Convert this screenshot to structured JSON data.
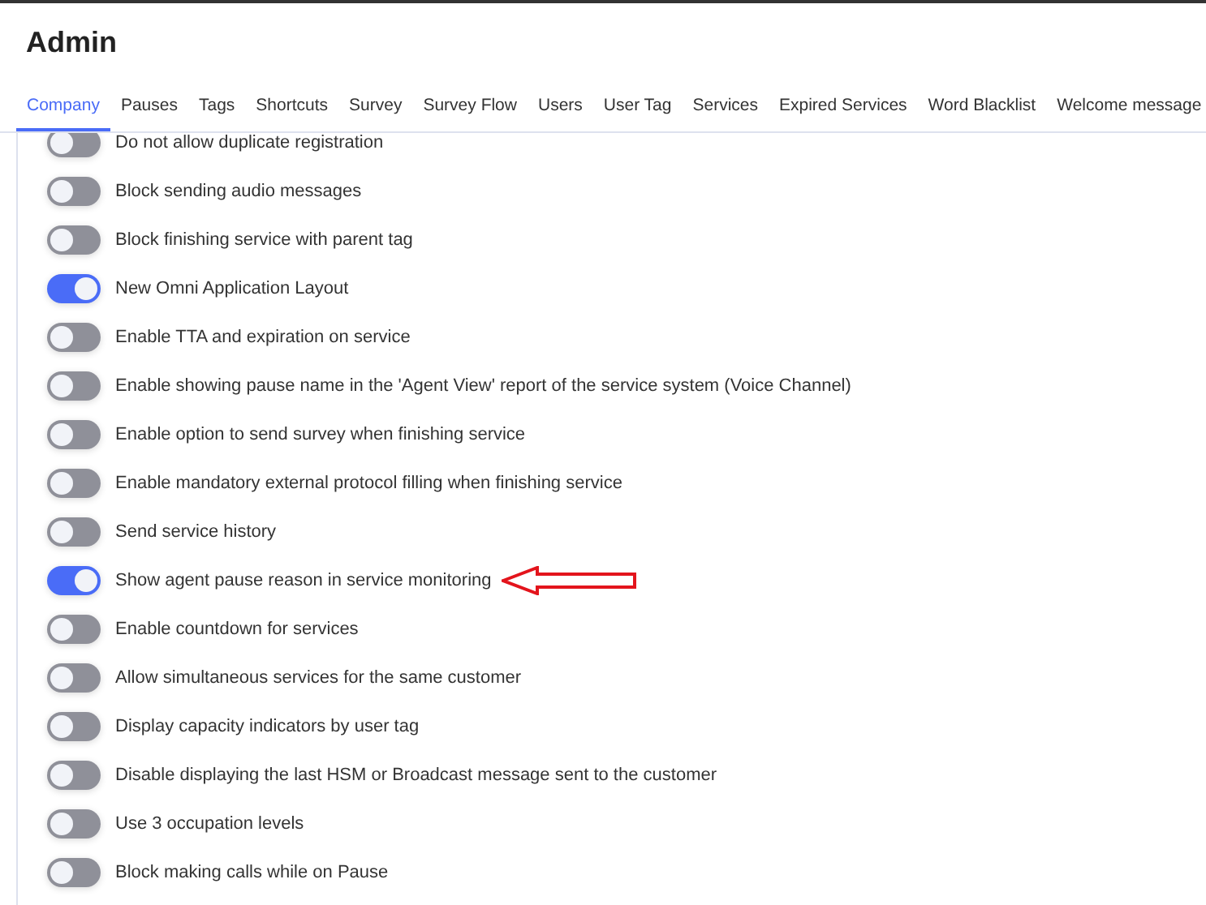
{
  "title": "Admin",
  "tabs": [
    {
      "label": "Company",
      "selected": true
    },
    {
      "label": "Pauses",
      "selected": false
    },
    {
      "label": "Tags",
      "selected": false
    },
    {
      "label": "Shortcuts",
      "selected": false
    },
    {
      "label": "Survey",
      "selected": false
    },
    {
      "label": "Survey Flow",
      "selected": false
    },
    {
      "label": "Users",
      "selected": false
    },
    {
      "label": "User Tag",
      "selected": false
    },
    {
      "label": "Services",
      "selected": false
    },
    {
      "label": "Expired Services",
      "selected": false
    },
    {
      "label": "Word Blacklist",
      "selected": false
    },
    {
      "label": "Welcome message",
      "selected": false
    }
  ],
  "settings": [
    {
      "label": "Do not allow duplicate registration",
      "on": false,
      "highlighted": false
    },
    {
      "label": "Block sending audio messages",
      "on": false,
      "highlighted": false
    },
    {
      "label": "Block finishing service with parent tag",
      "on": false,
      "highlighted": false
    },
    {
      "label": "New Omni Application Layout",
      "on": true,
      "highlighted": false
    },
    {
      "label": "Enable TTA and expiration on service",
      "on": false,
      "highlighted": false
    },
    {
      "label": "Enable showing pause name in the 'Agent View' report of the service system (Voice Channel)",
      "on": false,
      "highlighted": false
    },
    {
      "label": "Enable option to send survey when finishing service",
      "on": false,
      "highlighted": false
    },
    {
      "label": "Enable mandatory external protocol filling when finishing service",
      "on": false,
      "highlighted": false
    },
    {
      "label": "Send service history",
      "on": false,
      "highlighted": false
    },
    {
      "label": "Show agent pause reason in service monitoring",
      "on": true,
      "highlighted": true
    },
    {
      "label": "Enable countdown for services",
      "on": false,
      "highlighted": false
    },
    {
      "label": "Allow simultaneous services for the same customer",
      "on": false,
      "highlighted": false
    },
    {
      "label": "Display capacity indicators by user tag",
      "on": false,
      "highlighted": false
    },
    {
      "label": "Disable displaying the last HSM or Broadcast message sent to the customer",
      "on": false,
      "highlighted": false
    },
    {
      "label": "Use 3 occupation levels",
      "on": false,
      "highlighted": false
    },
    {
      "label": "Block making calls while on Pause",
      "on": false,
      "highlighted": false
    }
  ]
}
